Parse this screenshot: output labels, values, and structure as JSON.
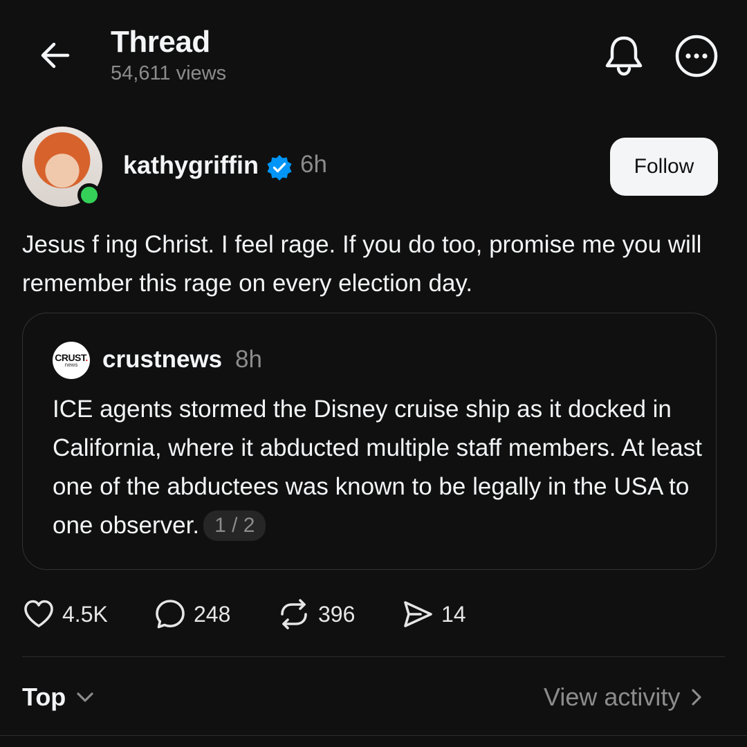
{
  "header": {
    "title": "Thread",
    "views": "54,611 views",
    "icons": {
      "back": "arrow-left-icon",
      "notify": "bell-icon",
      "more": "more-horizontal-icon"
    }
  },
  "post": {
    "username": "kathygriffin",
    "verified": true,
    "time": "6h",
    "follow_label": "Follow",
    "text": "Jesus f ing Christ. I feel rage. If you do too, promise me you will remember this rage on every election day.",
    "quote": {
      "logo_text": "CRUST.",
      "logo_subtext": "news",
      "username": "crustnews",
      "time": "8h",
      "text": "ICE agents stormed the Disney cruise ship as it docked in California, where it abducted multiple staff members. At least one of the abductees was known to be legally in the USA to one observer.",
      "page_indicator": "1 / 2"
    },
    "actions": {
      "likes": "4.5K",
      "replies": "248",
      "reposts": "396",
      "shares": "14"
    }
  },
  "replies_bar": {
    "sort_label": "Top",
    "view_activity_label": "View activity"
  },
  "colors": {
    "background": "#101010",
    "text": "#f3f5f7",
    "muted": "#8c8c8c",
    "verified": "#0095f6",
    "online": "#34d058"
  }
}
